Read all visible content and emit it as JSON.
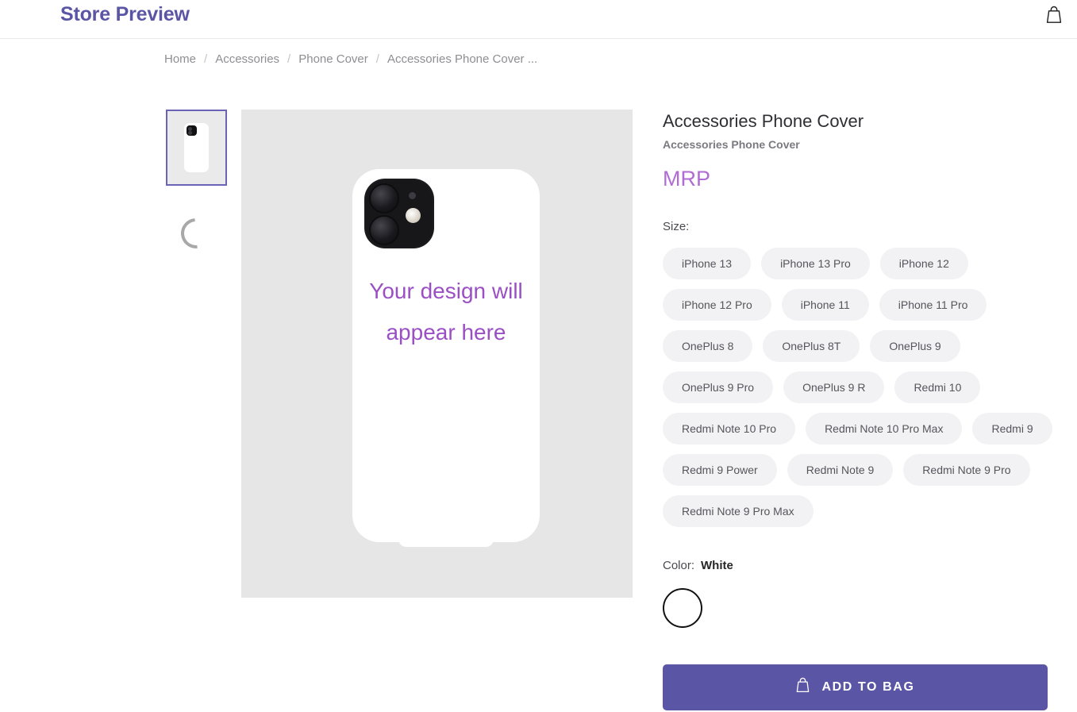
{
  "header": {
    "brand_title": "Store Preview",
    "bag_icon": "shopping-bag-icon"
  },
  "breadcrumb": {
    "separator": "/",
    "items": [
      {
        "label": "Home"
      },
      {
        "label": "Accessories"
      },
      {
        "label": "Phone Cover"
      },
      {
        "label": "Accessories Phone Cover ..."
      }
    ]
  },
  "gallery": {
    "thumbnail_alt": "Accessories Phone Cover thumbnail",
    "loading_indicator": "spinner-icon",
    "design_placeholder": "Your design will appear here"
  },
  "product": {
    "title": "Accessories Phone Cover",
    "subtitle": "Accessories Phone Cover",
    "price": "MRP",
    "size_label": "Size:",
    "sizes": [
      "iPhone 13",
      "iPhone 13 Pro",
      "iPhone 12",
      "iPhone 12 Pro",
      "iPhone 11",
      "iPhone 11 Pro",
      "OnePlus 8",
      "OnePlus 8T",
      "OnePlus 9",
      "OnePlus 9 Pro",
      "OnePlus 9 R",
      "Redmi 10",
      "Redmi Note 10 Pro",
      "Redmi Note 10 Pro Max",
      "Redmi 9",
      "Redmi 9 Power",
      "Redmi Note 9",
      "Redmi Note 9 Pro",
      "Redmi Note 9 Pro Max"
    ],
    "color_label": "Color:",
    "color_value": "White",
    "color_swatch_hex": "#ffffff",
    "add_to_bag_label": "ADD TO BAG"
  },
  "theme": {
    "brand_purple": "#5b55a5",
    "price_purple": "#b06cd4",
    "placeholder_purple": "#9b4fc4",
    "stage_gray": "#e6e6e6",
    "pill_gray": "#f2f2f4"
  }
}
